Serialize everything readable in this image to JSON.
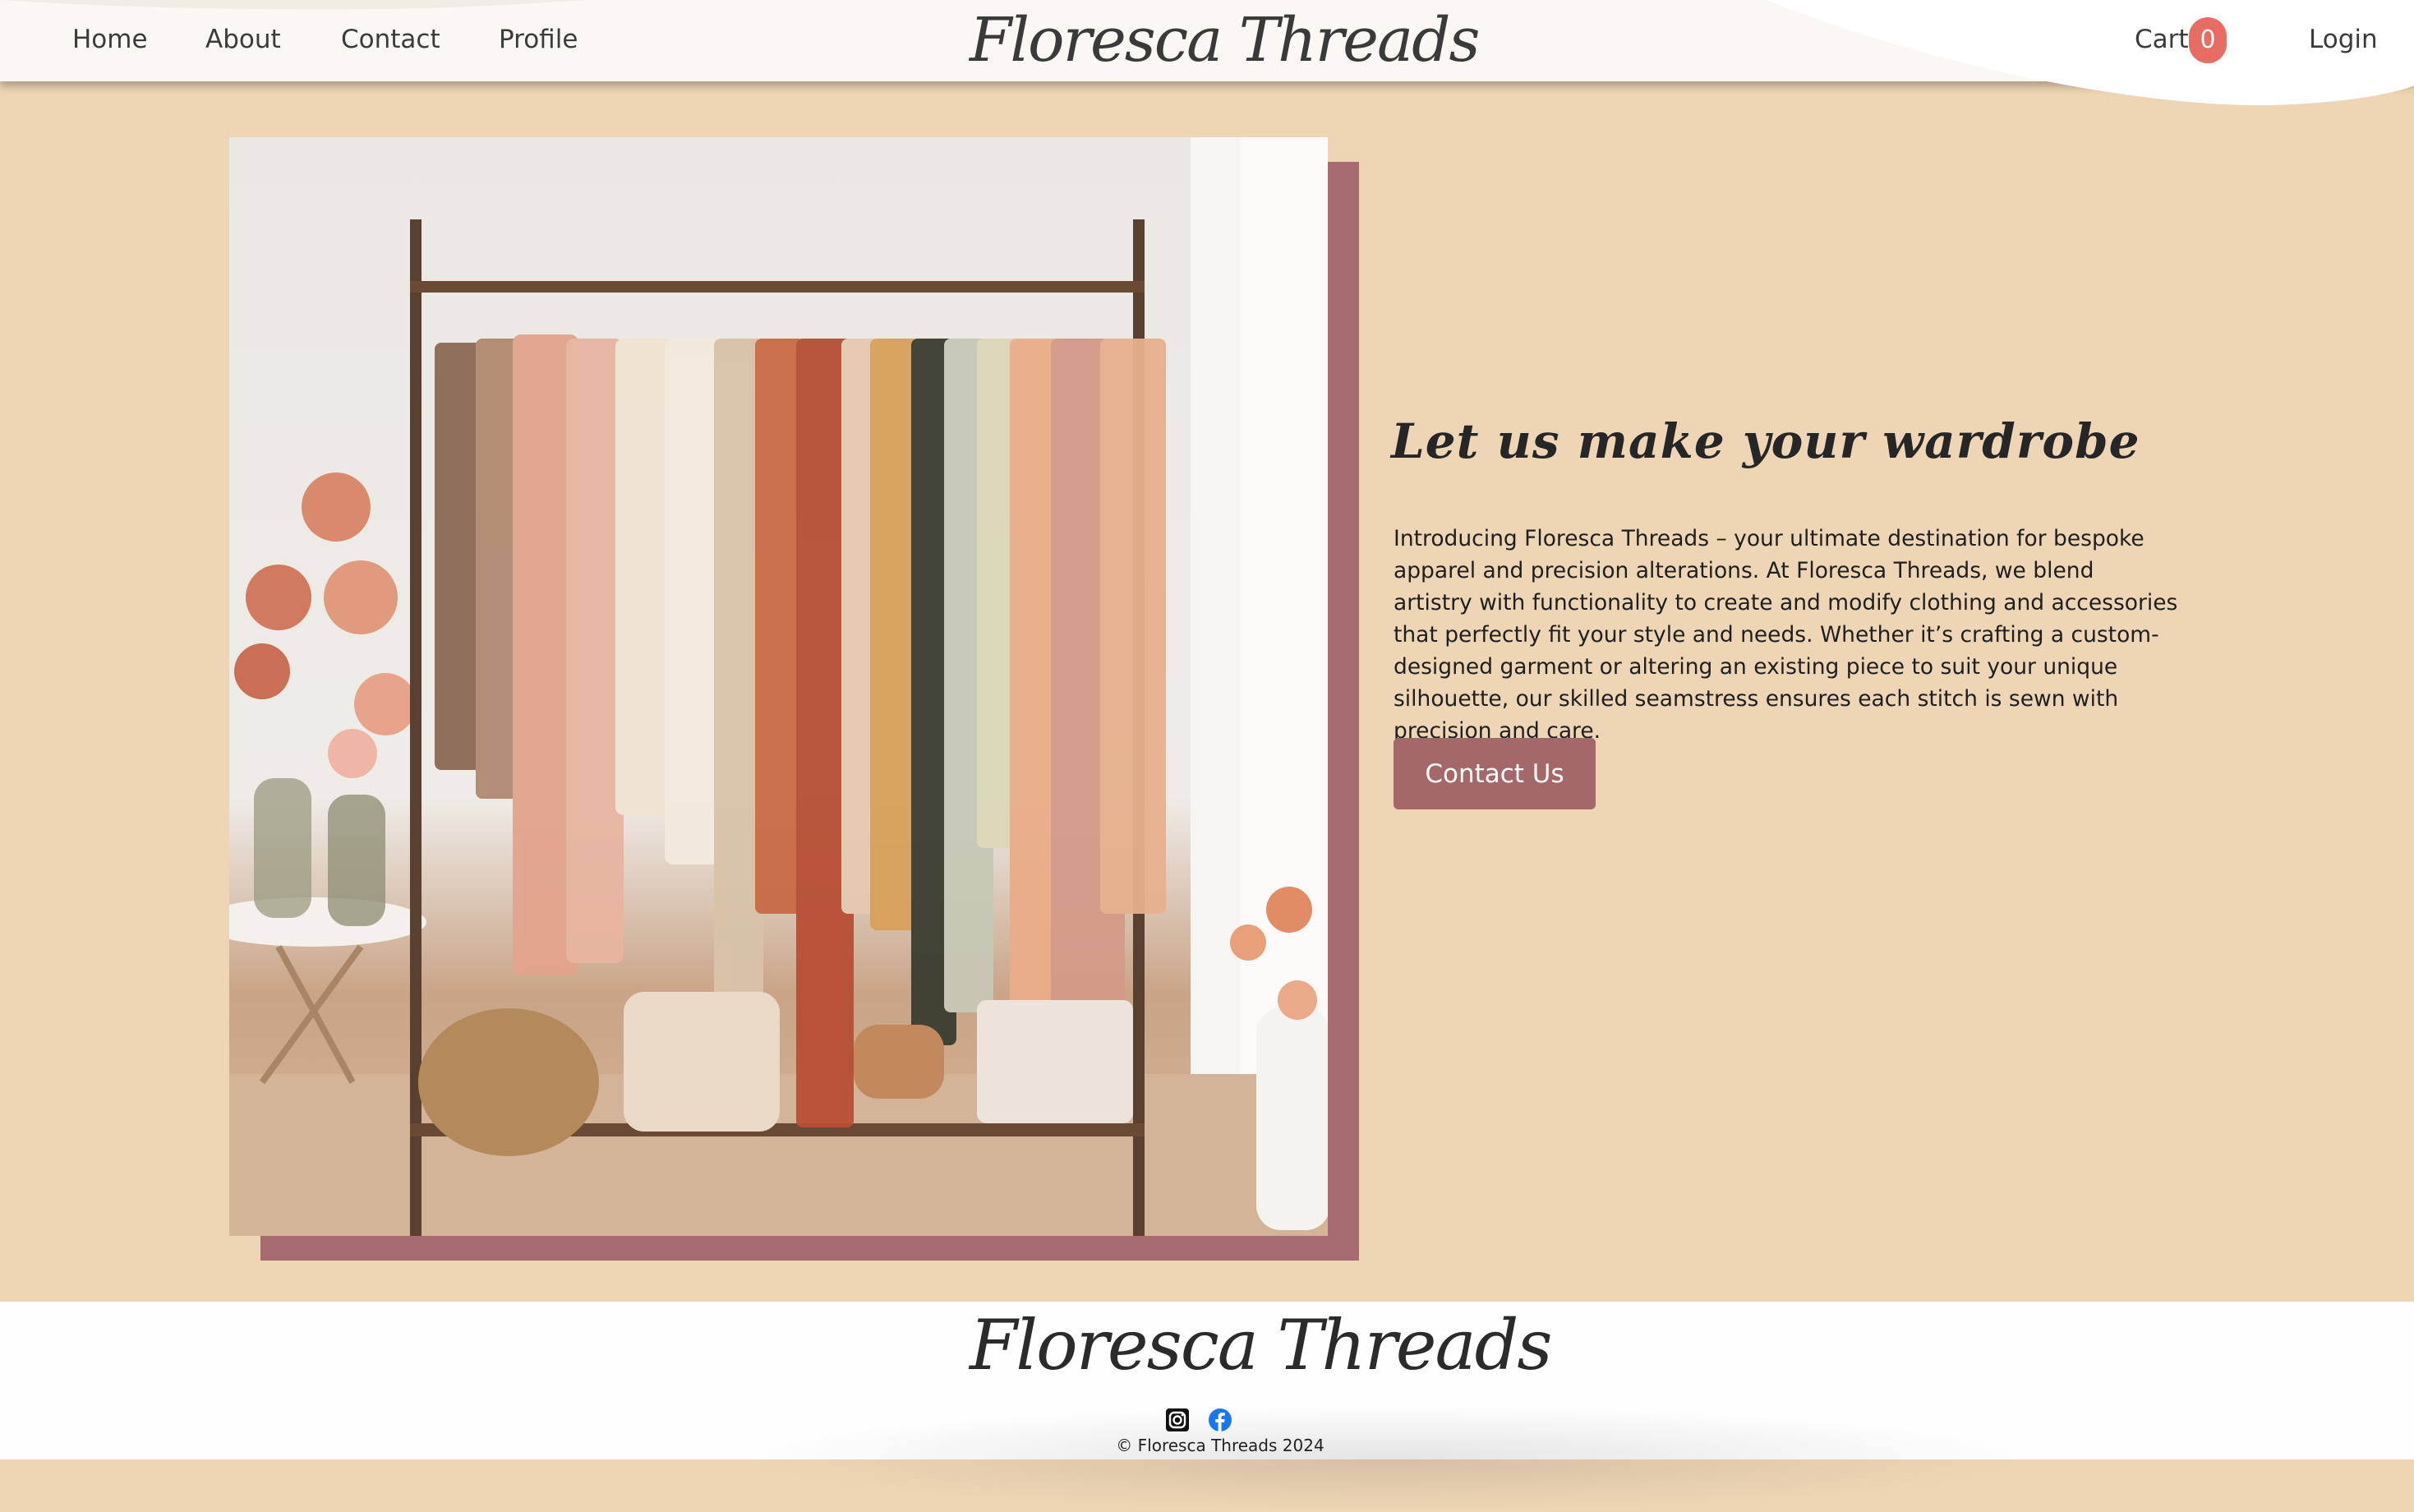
{
  "nav": {
    "home": "Home",
    "about": "About",
    "contact": "Contact",
    "profile": "Profile",
    "brand": "Floresca Threads",
    "cart_label": "Cart",
    "cart_count": "0",
    "login": "Login"
  },
  "hero": {
    "heading": "Let us make your wardrobe",
    "body": "Introducing Floresca Threads – your ultimate destination for bespoke apparel and precision alterations. At Floresca Threads, we blend artistry with functionality to create and modify clothing and accessories that perfectly fit your style and needs. Whether it’s crafting a custom-designed garment or altering an existing piece to suit your unique silhouette, our skilled seamstress ensures each stitch is sewn with precision and care.",
    "cta": "Contact Us"
  },
  "footer": {
    "brand": "Floresca Threads",
    "social_icons": [
      "instagram-icon",
      "facebook-icon"
    ],
    "copyright": "© Floresca Threads 2024"
  },
  "colors": {
    "page_bg": "#eed5b6",
    "accent": "#a4676a",
    "badge": "#e86c62",
    "header_bg": "#fbf8f4"
  }
}
